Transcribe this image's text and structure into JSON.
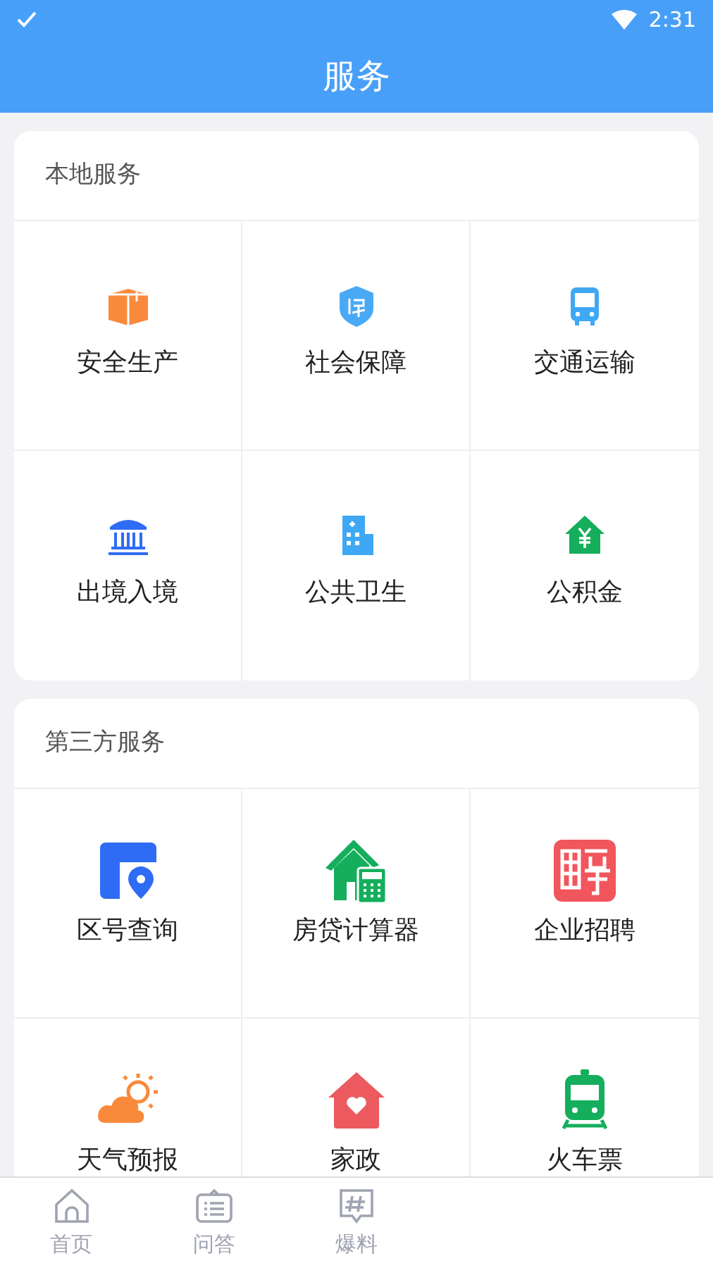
{
  "status_bar": {
    "time": "2:31"
  },
  "header": {
    "title": "服务"
  },
  "sections": [
    {
      "title": "本地服务",
      "items": [
        {
          "label": "安全生产",
          "kind": "box"
        },
        {
          "label": "社会保障",
          "kind": "shield"
        },
        {
          "label": "交通运输",
          "kind": "bus"
        },
        {
          "label": "出境入境",
          "kind": "bank"
        },
        {
          "label": "公共卫生",
          "kind": "hospital"
        },
        {
          "label": "公积金",
          "kind": "house_yen"
        }
      ]
    },
    {
      "title": "第三方服务",
      "items": [
        {
          "label": "区号查询",
          "kind": "pin"
        },
        {
          "label": "房贷计算器",
          "kind": "house_calc"
        },
        {
          "label": "企业招聘",
          "kind": "hire"
        },
        {
          "label": "天气预报",
          "kind": "weather"
        },
        {
          "label": "家政",
          "kind": "house_heart"
        },
        {
          "label": "火车票",
          "kind": "train"
        }
      ]
    }
  ],
  "tabs": [
    {
      "label": "首页",
      "kind": "home",
      "selected": false
    },
    {
      "label": "问答",
      "kind": "qa",
      "selected": false
    },
    {
      "label": "爆料",
      "kind": "tip",
      "selected": false
    }
  ]
}
